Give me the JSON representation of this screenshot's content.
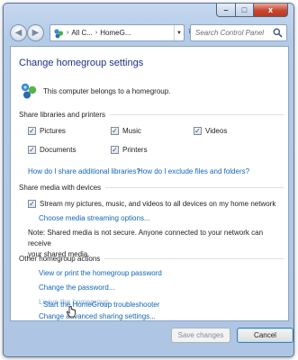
{
  "navbar": {
    "address_root": "All C...",
    "address_leaf": "HomeG...",
    "search_placeholder": "Search Control Panel"
  },
  "page": {
    "title": "Change homegroup settings",
    "membership_text": "This computer belongs to a homegroup."
  },
  "share_libraries": {
    "heading": "Share libraries and printers",
    "items": [
      {
        "label": "Pictures",
        "checked": true
      },
      {
        "label": "Music",
        "checked": true
      },
      {
        "label": "Videos",
        "checked": true
      },
      {
        "label": "Documents",
        "checked": true
      },
      {
        "label": "Printers",
        "checked": true
      }
    ],
    "link_additional": "How do I share additional libraries?",
    "link_exclude": "How do I exclude files and folders?"
  },
  "share_media": {
    "heading": "Share media with devices",
    "stream_label": "Stream my pictures, music, and videos to all devices on my home network",
    "stream_checked": true,
    "link_options": "Choose media streaming options...",
    "note_line1": "Note: Shared media is not secure. Anyone connected to your network can receive",
    "note_line2": "your shared media."
  },
  "other_actions": {
    "heading": "Other homegroup actions",
    "links": [
      "View or print the homegroup password",
      "Change the password...",
      "Leave the homegroup...",
      "Change advanced sharing settings...",
      "Start the HomeGroup troubleshooter"
    ]
  },
  "footer": {
    "save_label": "Save changes",
    "cancel_label": "Cancel"
  },
  "caption": {
    "minimize": "–",
    "maximize": "□",
    "close": "x"
  },
  "colors": {
    "title": "#1e3287",
    "link": "#1366b5",
    "frame": "#b3cbe7"
  }
}
